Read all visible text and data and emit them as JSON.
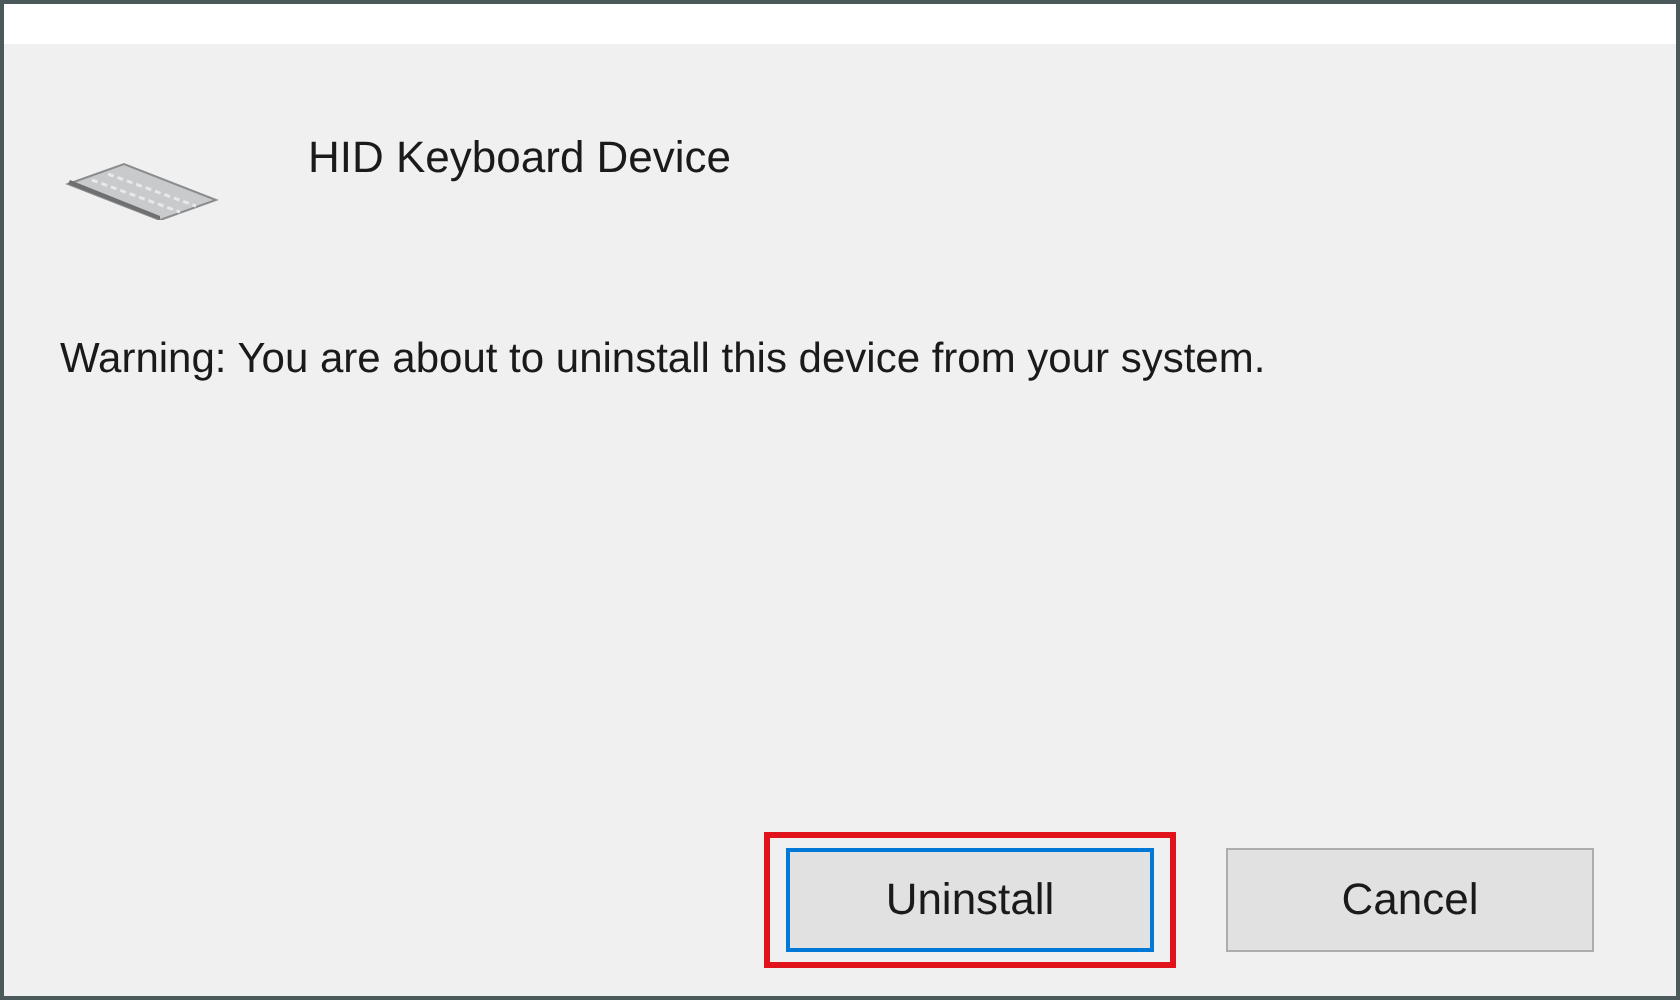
{
  "device": {
    "name": "HID Keyboard Device"
  },
  "warning": "Warning: You are about to uninstall this device from your system.",
  "buttons": [
    {
      "label": "Uninstall",
      "default": true,
      "highlighted": true
    },
    {
      "label": "Cancel",
      "default": false,
      "highlighted": false
    }
  ]
}
